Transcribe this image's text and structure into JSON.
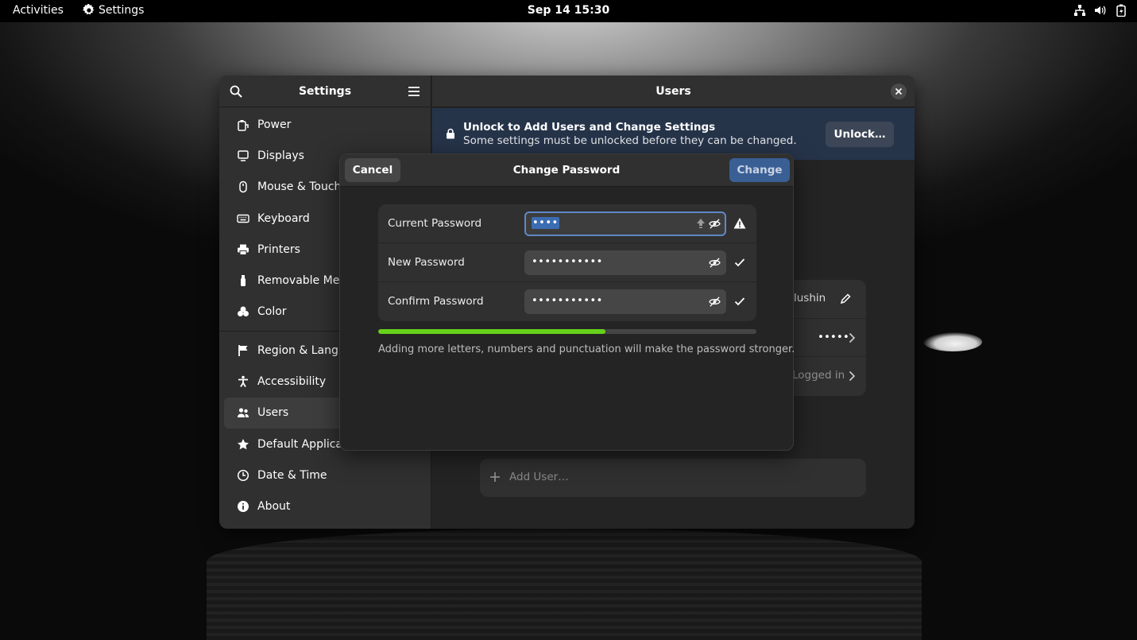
{
  "topbar": {
    "activities": "Activities",
    "app_name": "Settings",
    "clock": "Sep 14  15:30",
    "tray_icons": [
      "network-icon",
      "volume-icon",
      "battery-icon"
    ]
  },
  "window": {
    "sidebar_title": "Settings",
    "sidebar_items": [
      {
        "label": "Power",
        "icon": "power-icon"
      },
      {
        "label": "Displays",
        "icon": "display-icon"
      },
      {
        "label": "Mouse & Touchpad",
        "icon": "mouse-icon"
      },
      {
        "label": "Keyboard",
        "icon": "keyboard-icon"
      },
      {
        "label": "Printers",
        "icon": "printer-icon"
      },
      {
        "label": "Removable Media",
        "icon": "usb-icon"
      },
      {
        "label": "Color",
        "icon": "color-icon"
      },
      {
        "label": "Region & Language",
        "icon": "flag-icon"
      },
      {
        "label": "Accessibility",
        "icon": "accessibility-icon"
      },
      {
        "label": "Users",
        "icon": "users-icon",
        "active": true
      },
      {
        "label": "Default Applications",
        "icon": "star-icon"
      },
      {
        "label": "Date & Time",
        "icon": "clock-icon"
      },
      {
        "label": "About",
        "icon": "info-icon"
      }
    ],
    "main_title": "Users",
    "banner": {
      "title": "Unlock to Add Users and Change Settings",
      "subtitle": "Some settings must be unlocked before they can be changed.",
      "button": "Unlock…"
    },
    "user_rows": {
      "name_fragment": "lushin",
      "password_value": "•••••",
      "last_login_fragment": "Logged in"
    },
    "add_user": "Add User…"
  },
  "dialog": {
    "title": "Change Password",
    "cancel": "Cancel",
    "change": "Change",
    "fields": [
      {
        "label": "Current Password",
        "value": "••••",
        "status": "warning-icon"
      },
      {
        "label": "New Password",
        "value": "•••••••••••",
        "status": "check-icon"
      },
      {
        "label": "Confirm Password",
        "value": "•••••••••••",
        "status": "check-icon"
      }
    ],
    "strength_fraction": 0.6,
    "strength_color": "#66d11a",
    "hint": "Adding more letters, numbers and punctuation will make the password stronger."
  }
}
